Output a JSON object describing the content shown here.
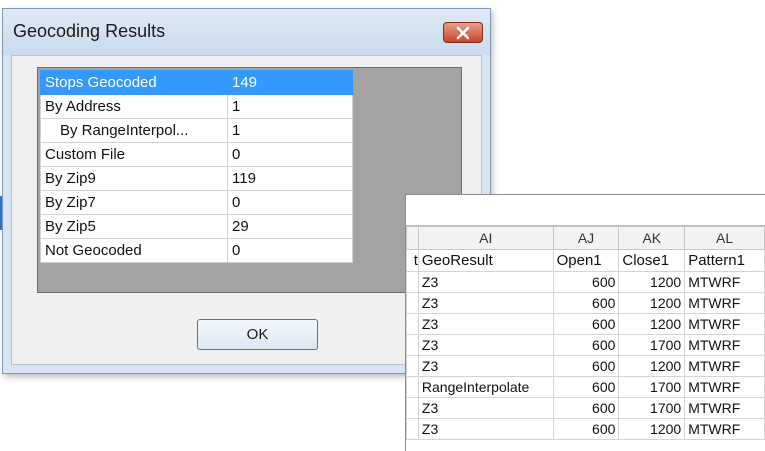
{
  "dialog": {
    "title": "Geocoding Results",
    "close_icon": "close-icon",
    "ok_label": "OK",
    "rows": [
      {
        "label": "Stops Geocoded",
        "value": "149",
        "selected": true
      },
      {
        "label": "By Address",
        "value": "1"
      },
      {
        "label": "By RangeInterpol...",
        "value": "1",
        "indent": true
      },
      {
        "label": "Custom File",
        "value": "0"
      },
      {
        "label": "By Zip9",
        "value": "119"
      },
      {
        "label": "By Zip7",
        "value": "0"
      },
      {
        "label": "By Zip5",
        "value": "29"
      },
      {
        "label": "Not Geocoded",
        "value": "0"
      }
    ]
  },
  "spreadsheet": {
    "column_letters": [
      "AI",
      "AJ",
      "AK",
      "AL"
    ],
    "header_fragment": "t",
    "headers": [
      "GeoResult",
      "Open1",
      "Close1",
      "Pattern1"
    ],
    "rows": [
      [
        "Z3",
        "600",
        "1200",
        "MTWRF"
      ],
      [
        "Z3",
        "600",
        "1200",
        "MTWRF"
      ],
      [
        "Z3",
        "600",
        "1200",
        "MTWRF"
      ],
      [
        "Z3",
        "600",
        "1700",
        "MTWRF"
      ],
      [
        "Z3",
        "600",
        "1200",
        "MTWRF"
      ],
      [
        "RangeInterpolate",
        "600",
        "1700",
        "MTWRF"
      ],
      [
        "Z3",
        "600",
        "1700",
        "MTWRF"
      ],
      [
        "Z3",
        "600",
        "1200",
        "MTWRF"
      ]
    ]
  }
}
